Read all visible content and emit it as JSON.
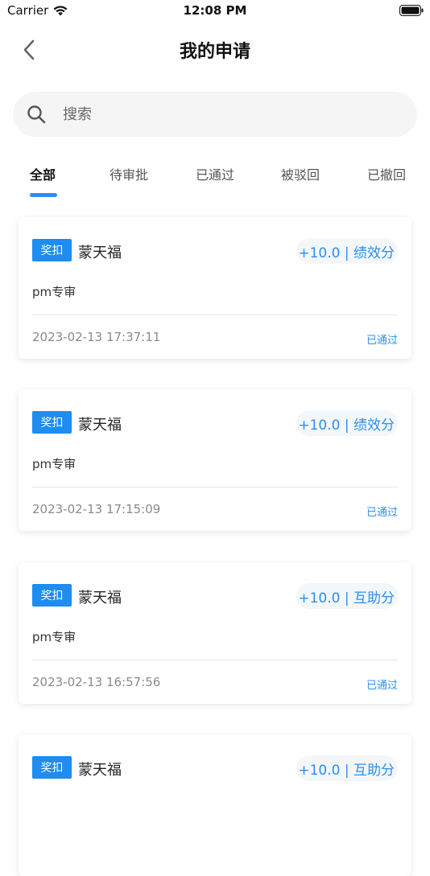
{
  "status_bar": {
    "carrier": "Carrier",
    "time": "12:08 PM"
  },
  "nav": {
    "title": "我的申请"
  },
  "search": {
    "placeholder": "搜索"
  },
  "tabs": [
    {
      "label": "全部",
      "active": true
    },
    {
      "label": "待审批",
      "active": false
    },
    {
      "label": "已通过",
      "active": false
    },
    {
      "label": "被驳回",
      "active": false
    },
    {
      "label": "已撤回",
      "active": false
    }
  ],
  "cards": [
    {
      "badge": "奖扣",
      "name": "蒙天福",
      "points": "+10.0 | 绩效分",
      "desc": "pm专审",
      "time": "2023-02-13 17:37:11",
      "status": "已通过"
    },
    {
      "badge": "奖扣",
      "name": "蒙天福",
      "points": "+10.0 | 绩效分",
      "desc": "pm专审",
      "time": "2023-02-13 17:15:09",
      "status": "已通过"
    },
    {
      "badge": "奖扣",
      "name": "蒙天福",
      "points": "+10.0 | 互助分",
      "desc": "pm专审",
      "time": "2023-02-13 16:57:56",
      "status": "已通过"
    },
    {
      "badge": "奖扣",
      "name": "蒙天福",
      "points": "+10.0 | 互助分",
      "desc": "",
      "time": "",
      "status": ""
    }
  ],
  "colors": {
    "accent": "#2b8ff0",
    "badge": "#1e8cf0"
  }
}
